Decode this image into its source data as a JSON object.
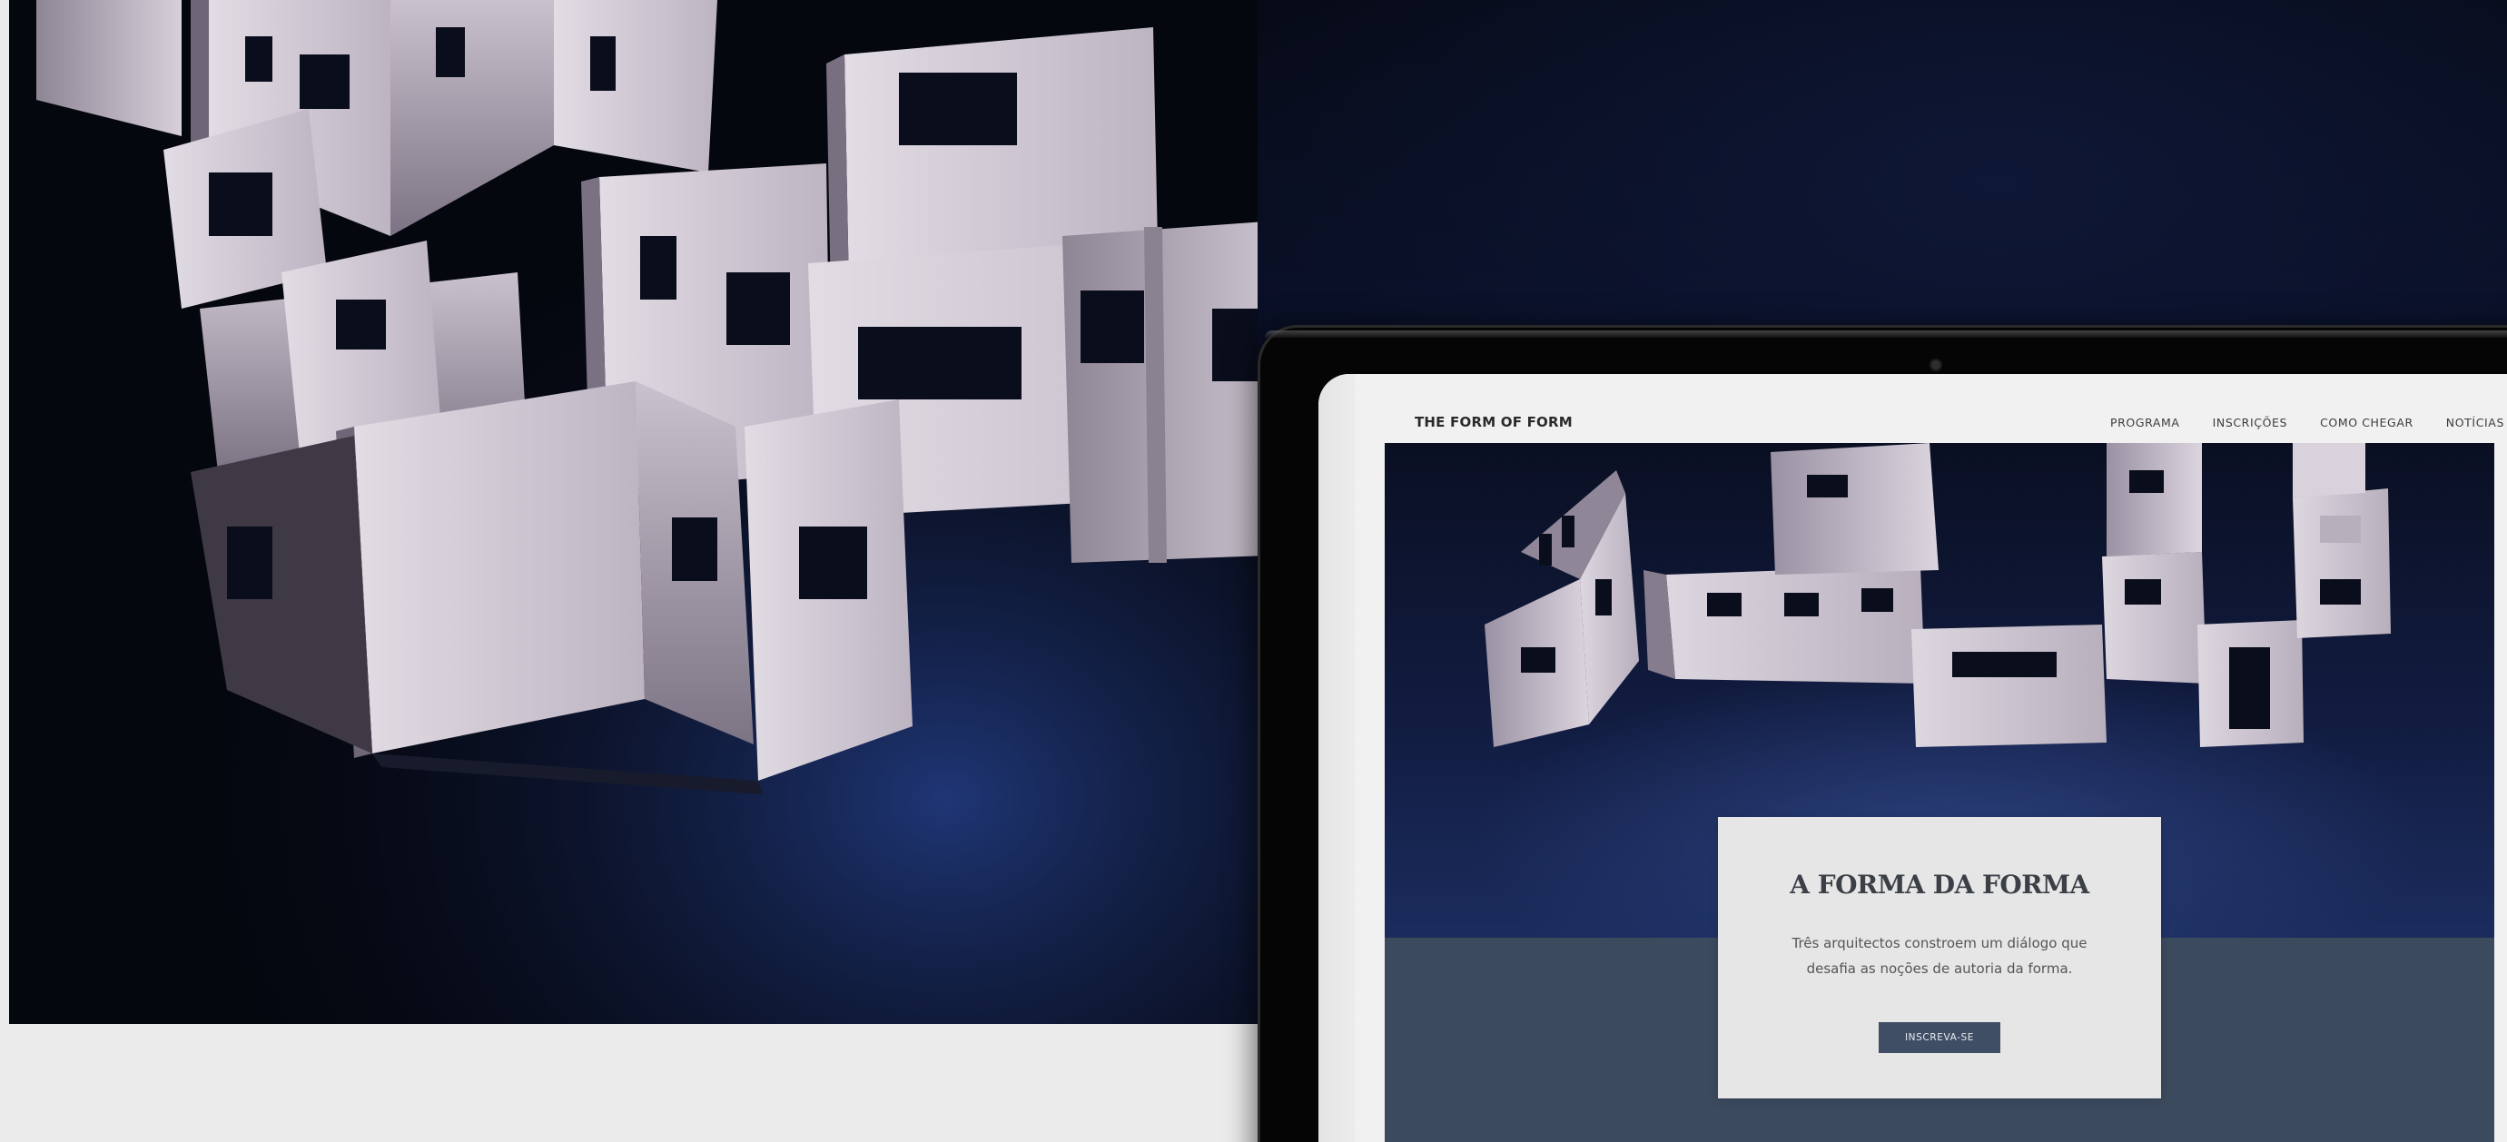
{
  "site": {
    "logo": "THE FORM OF FORM",
    "nav": [
      {
        "label": "PROGRAMA"
      },
      {
        "label": "INSCRIÇÕES"
      },
      {
        "label": "COMO CHEGAR"
      },
      {
        "label": "NOTÍCIAS"
      }
    ]
  },
  "hero": {
    "title": "A FORMA DA FORMA",
    "description_line1": "Três arquitectos constroem um diálogo que",
    "description_line2": "desafia as noções de autoria da forma.",
    "cta_label": "INSCREVA-SE"
  },
  "colors": {
    "page_background": "#ebebeb",
    "backdrop_navy": "#0b1230",
    "hero_slate": "#3c4a5e",
    "card_background": "#e6e6e6",
    "cta_background": "#3f4e64",
    "model_white": "#d9d3dc"
  }
}
